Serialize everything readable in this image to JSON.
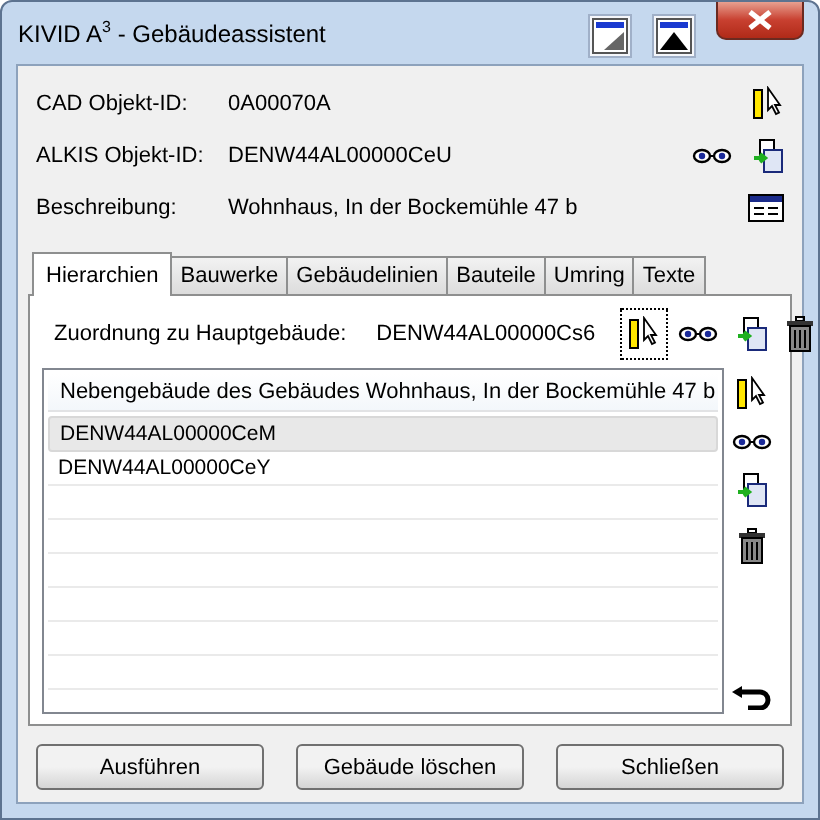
{
  "window": {
    "title": "KIVID A$^{3}$ - Gebäudeassistent"
  },
  "fields": [
    {
      "label": "CAD Objekt-ID:",
      "value": "0A00070A",
      "icons": [
        {
          "kind": "select"
        }
      ]
    },
    {
      "label": "ALKIS Objekt-ID:",
      "value": "DENW44AL00000CeU",
      "icons": [
        {
          "kind": "view"
        },
        {
          "kind": "copy"
        }
      ]
    },
    {
      "label": "Beschreibung:",
      "value": "Wohnhaus, In der Bockemühle 47 b",
      "icons": [
        {
          "kind": "form"
        }
      ]
    }
  ],
  "tabs": [
    {
      "label": "Hierarchien",
      "selected": true
    },
    {
      "label": "Bauwerke",
      "selected": false
    },
    {
      "label": "Gebäudelinien",
      "selected": false
    },
    {
      "label": "Bauteile",
      "selected": false
    },
    {
      "label": "Umring",
      "selected": false
    },
    {
      "label": "Texte",
      "selected": false
    }
  ],
  "assignment": {
    "label": "Zuordnung zu Hauptgebäude:",
    "value": "DENW44AL00000Cs6",
    "icons": [
      {
        "kind": "select"
      },
      {
        "kind": "view"
      },
      {
        "kind": "copy"
      },
      {
        "kind": "trash"
      }
    ]
  },
  "list": {
    "header": "Nebengebäude des Gebäudes Wohnhaus, In der Bockemühle 47 b",
    "rows": [
      {
        "text": "DENW44AL00000CeM",
        "selected": true
      },
      {
        "text": "DENW44AL00000CeY",
        "selected": false
      }
    ],
    "icons": [
      {
        "kind": "select"
      },
      {
        "kind": "view"
      },
      {
        "kind": "copy"
      },
      {
        "kind": "trash"
      },
      {
        "kind": "undo"
      }
    ]
  },
  "buttons": [
    "Ausführen",
    "Gebäude löschen",
    "Schließen"
  ]
}
